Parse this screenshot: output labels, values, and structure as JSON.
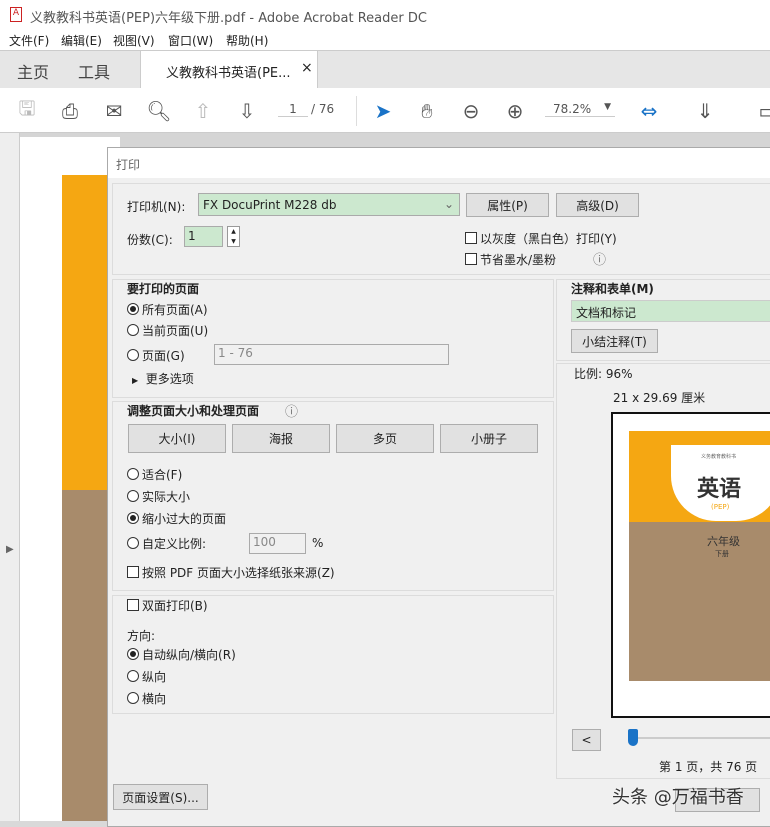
{
  "window": {
    "title": "义教教科书英语(PEP)六年级下册.pdf - Adobe Acrobat Reader DC"
  },
  "menu": [
    "文件(F)",
    "编辑(E)",
    "视图(V)",
    "窗口(W)",
    "帮助(H)"
  ],
  "tabs": {
    "home": "主页",
    "tools": "工具",
    "document": "义教教科书英语(PE...",
    "close": "×"
  },
  "toolbar": {
    "page_current": "1",
    "page_total": "/ 76",
    "zoom": "78.2%"
  },
  "dialog": {
    "title": "打印",
    "printer_label": "打印机(N):",
    "printer_value": "FX DocuPrint M228 db",
    "properties": "属性(P)",
    "advanced": "高级(D)",
    "copies_label": "份数(C):",
    "copies_value": "1",
    "grayscale": "以灰度（黑白色）打印(Y)",
    "save_ink": "节省墨水/墨粉",
    "pages": {
      "title": "要打印的页面",
      "all": "所有页面(A)",
      "current": "当前页面(U)",
      "range": "页面(G)",
      "range_placeholder": "1 - 76",
      "more": "更多选项",
      "selected": "all"
    },
    "sizing": {
      "title": "调整页面大小和处理页面",
      "buttons": [
        "大小(I)",
        "海报",
        "多页",
        "小册子"
      ],
      "fit": "适合(F)",
      "actual": "实际大小",
      "shrink": "缩小过大的页面",
      "custom": "自定义比例:",
      "custom_value": "100",
      "percent": "%",
      "paper_source": "按照 PDF 页面大小选择纸张来源(Z)",
      "selected": "shrink"
    },
    "duplex": "双面打印(B)",
    "orientation": {
      "title": "方向:",
      "auto": "自动纵向/横向(R)",
      "portrait": "纵向",
      "landscape": "横向",
      "selected": "auto"
    },
    "comments": {
      "title": "注释和表单(M)",
      "value": "文档和标记",
      "summarize": "小结注释(T)"
    },
    "preview": {
      "scale": "比例:  96%",
      "size": "21 x 29.69 厘米",
      "prev": "<",
      "page_info": "第 1 页，共 76 页",
      "cover": {
        "series": "义务教育教科书",
        "title": "英语",
        "subtitle": "(PEP)",
        "grade": "六年级",
        "volume": "下册"
      },
      "slider_fraction": 0.0
    },
    "page_setup": "页面设置(S)..."
  },
  "watermark": "头条 @万福书香",
  "colors": {
    "accent": "#1a73c7",
    "field_green": "#cce8cf",
    "cover_orange": "#f5a712",
    "cover_brown": "#a88b6b"
  }
}
